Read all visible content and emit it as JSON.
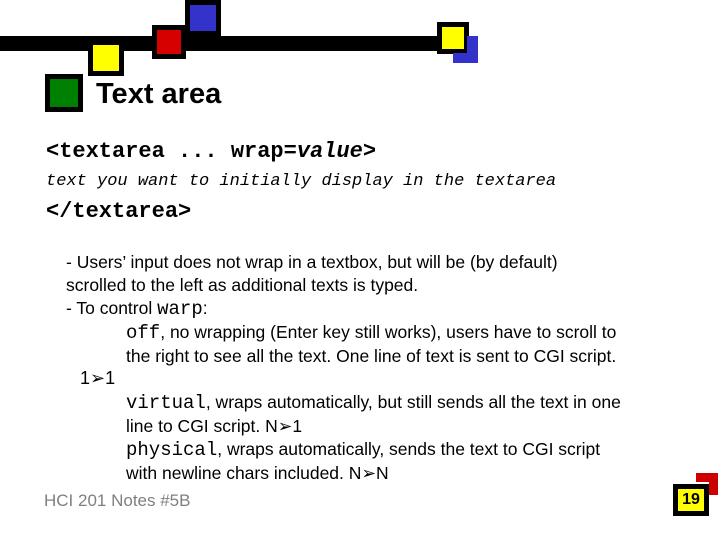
{
  "slide": {
    "title": "Text area",
    "decoration": {
      "bar_color": "#000000",
      "blue": "#3333cc",
      "red": "#d60000",
      "yellow": "#ffff00",
      "green": "#008000"
    }
  },
  "code": {
    "line1_prefix": "<textarea ... wrap=",
    "line1_italic": "value",
    "line1_suffix": ">",
    "line2": "text you want to initially display in the textarea",
    "line3": "</textarea>"
  },
  "body": {
    "bullet1_line1": "- Users’ input does not wrap in a textbox, but will be (by default)",
    "bullet1_line2": "scrolled to the left as additional texts is typed.",
    "bullet2_prefix": "- To control ",
    "bullet2_mono": "warp",
    "bullet2_suffix": ":",
    "off_mono": "off",
    "off_text_line1": ", no wrapping (Enter key still works), users have to scroll to",
    "off_text_line2": "the right to see all the text. One line of text is sent to CGI script.",
    "marker_1to1": "1➢1",
    "virtual_mono": "virtual",
    "virtual_text_line1": ", wraps automatically, but still sends all the text in one",
    "virtual_text_line2": "line to CGI script. N➢1",
    "physical_mono": "physical",
    "physical_text_line1": ", wraps automatically, sends the text to CGI script",
    "physical_text_line2": "with newline chars included. N➢N"
  },
  "footer": {
    "notes_label": "HCI 201 Notes #5B",
    "page_number": "19"
  }
}
